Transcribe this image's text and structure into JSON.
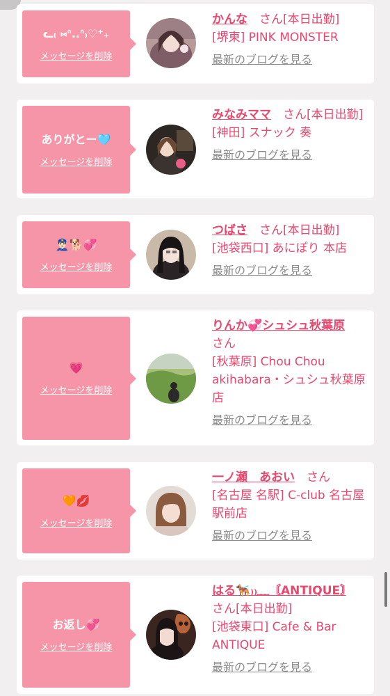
{
  "delete_label": "メッセージを削除",
  "blog_label": "最新のブログを見る",
  "san": "さん",
  "cards": [
    {
      "message": "ᓚ₍ ⑅ᐢ..ᐢ₎♡⁺₊",
      "name": "かんな",
      "status": "[本日出勤]",
      "shop": "[堺東] PINK MONSTER",
      "avatar": "girl-photo-1"
    },
    {
      "message": "ありがとー🩵",
      "name": "みなみママ",
      "status": "[本日出勤]",
      "shop": "[神田] スナック 奏",
      "avatar": "girl-photo-2"
    },
    {
      "message": "👮🏻‍♂️🐕💞",
      "name": "つばさ",
      "status": "[本日出勤]",
      "shop": "[池袋西口] あにぽり 本店",
      "avatar": "girl-photo-3"
    },
    {
      "message": "💗",
      "name": "りんか💞シュシュ秋葉原",
      "status": "",
      "shop": "[秋葉原] Chou Chou akihabara・シュシュ秋葉原店",
      "avatar": "girl-photo-4"
    },
    {
      "message": "🧡💋",
      "name": "一ノ瀬　あおい",
      "status": "",
      "shop": "[名古屋 名駅] C-club 名古屋駅前店",
      "avatar": "girl-photo-5"
    },
    {
      "message": "お返し💞",
      "name": "はる🐕‍🦺₎₎﹏〘ANTIQUE〙",
      "status": "[本日出勤]",
      "shop": "[池袋東口] Cafe & Bar ANTIQUE",
      "avatar": "girl-photo-6"
    }
  ]
}
